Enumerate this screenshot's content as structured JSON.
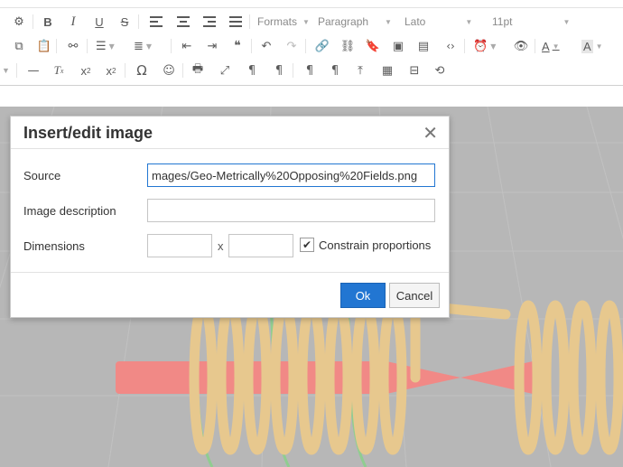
{
  "toolbar": {
    "formats_label": "Formats",
    "paragraph_label": "Paragraph",
    "font_label": "Lato",
    "size_label": "11pt",
    "text_color_label": "A",
    "bg_color_label": "A",
    "omega": "Ω",
    "subscript_base": "x",
    "subscript_mark": "2",
    "superscript_base": "x",
    "superscript_mark": "2",
    "quote": "❝",
    "code": "‹›"
  },
  "dialog": {
    "title": "Insert/edit image",
    "source_label": "Source",
    "source_value": "mages/Geo-Metrically%20Opposing%20Fields.png",
    "description_label": "Image description",
    "description_value": "",
    "dimensions_label": "Dimensions",
    "width_value": "",
    "height_value": "",
    "x_label": "x",
    "constrain_label": "Constrain proportions",
    "constrain_checked": true,
    "ok_label": "Ok",
    "cancel_label": "Cancel"
  },
  "colors": {
    "accent": "#2276d2",
    "coil": "#d8a64a",
    "rod": "#e8423c",
    "wire": "#4cae4c"
  }
}
